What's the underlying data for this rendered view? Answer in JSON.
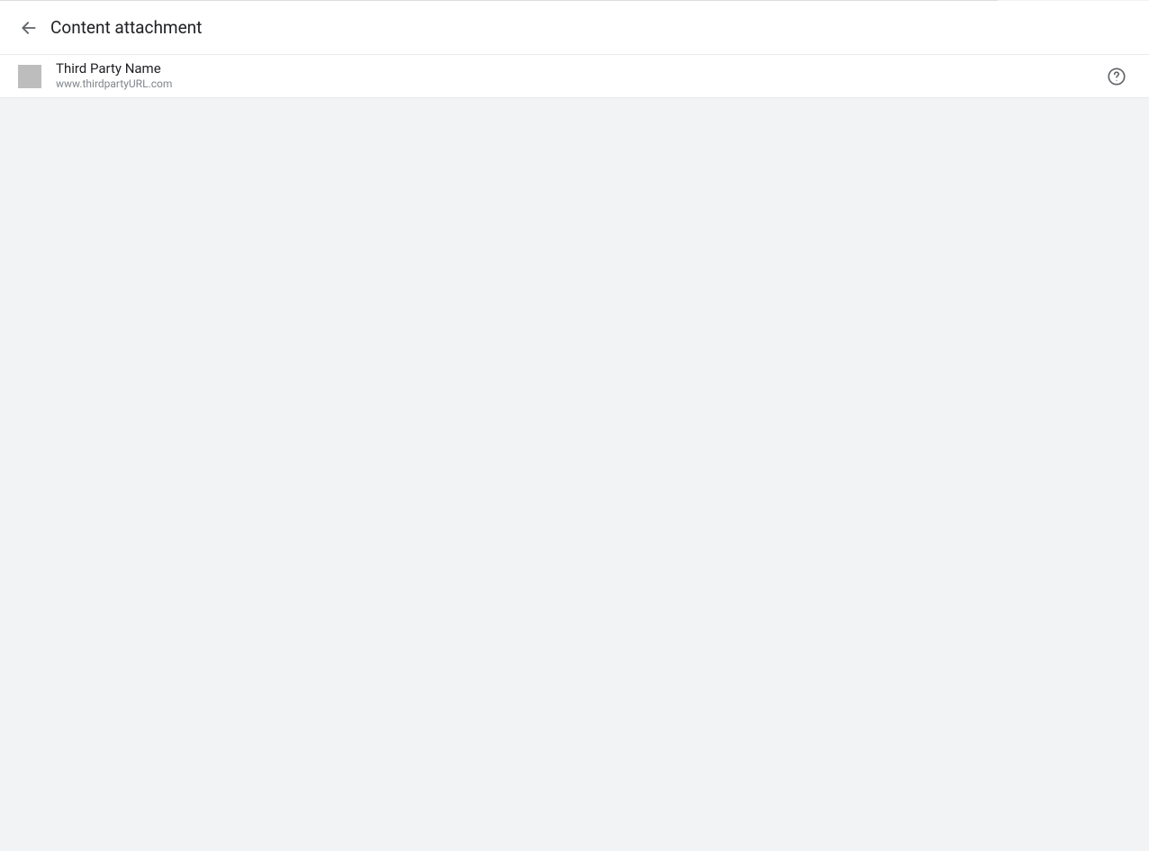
{
  "header": {
    "title": "Content attachment"
  },
  "thirdParty": {
    "name": "Third Party Name",
    "url": "www.thirdpartyURL.com"
  }
}
